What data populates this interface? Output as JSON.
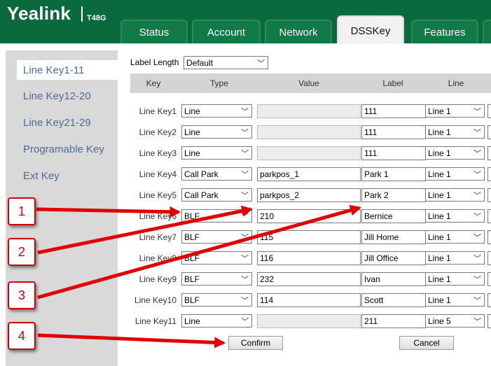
{
  "brand": {
    "logo": "Yealink",
    "model": "T48G"
  },
  "tabs": [
    {
      "label": "Status"
    },
    {
      "label": "Account"
    },
    {
      "label": "Network"
    },
    {
      "label": "DSSKey"
    },
    {
      "label": "Features"
    }
  ],
  "sidebar": {
    "items": [
      {
        "label": "Line Key1-11"
      },
      {
        "label": "Line Key12-20"
      },
      {
        "label": "Line Key21-29"
      },
      {
        "label": "Programable Key"
      },
      {
        "label": "Ext Key"
      }
    ]
  },
  "label_length": {
    "label": "Label Length",
    "value": "Default"
  },
  "table": {
    "headers": {
      "key": "Key",
      "type": "Type",
      "value": "Value",
      "label": "Label",
      "line": "Line"
    },
    "rows": [
      {
        "key": "Line Key1",
        "type": "Line",
        "value": "",
        "label": "111",
        "line": "Line 1"
      },
      {
        "key": "Line Key2",
        "type": "Line",
        "value": "",
        "label": "111",
        "line": "Line 1"
      },
      {
        "key": "Line Key3",
        "type": "Line",
        "value": "",
        "label": "111",
        "line": "Line 1"
      },
      {
        "key": "Line Key4",
        "type": "Call Park",
        "value": "parkpos_1",
        "label": "Park 1",
        "line": "Line 1"
      },
      {
        "key": "Line Key5",
        "type": "Call Park",
        "value": "parkpos_2",
        "label": "Park 2",
        "line": "Line 1"
      },
      {
        "key": "Line Key6",
        "type": "BLF",
        "value": "210",
        "label": "Bernice",
        "line": "Line 1"
      },
      {
        "key": "Line Key7",
        "type": "BLF",
        "value": "115",
        "label": "Jill Home",
        "line": "Line 1"
      },
      {
        "key": "Line Key8",
        "type": "BLF",
        "value": "116",
        "label": "Jill Office",
        "line": "Line 1"
      },
      {
        "key": "Line Key9",
        "type": "BLF",
        "value": "232",
        "label": "Ivan",
        "line": "Line 1"
      },
      {
        "key": "Line Key10",
        "type": "BLF",
        "value": "114",
        "label": "Scott",
        "line": "Line 1"
      },
      {
        "key": "Line Key11",
        "type": "Line",
        "value": "",
        "label": "211",
        "line": "Line 5"
      }
    ]
  },
  "buttons": {
    "confirm": "Confirm",
    "cancel": "Cancel"
  },
  "annotations": [
    "1",
    "2",
    "3",
    "4"
  ],
  "colors": {
    "header": "#0b6a3d",
    "tab": "#117a48",
    "sidebar": "#d9d9d9",
    "sidebar_text": "#4d6c94",
    "annotation": "#d10000"
  },
  "icons": {
    "dropdown": "chevron-down-icon"
  }
}
